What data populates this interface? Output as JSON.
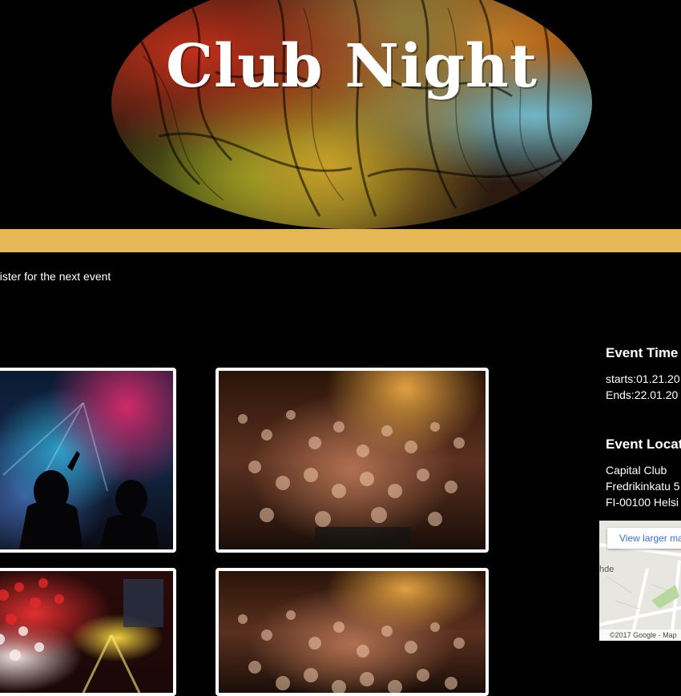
{
  "header": {
    "logo_text": "Club Night"
  },
  "intro": {
    "register_text": "gister for the next event"
  },
  "gallery": {
    "images": [
      {
        "name": "dj-stage-photo"
      },
      {
        "name": "crowd-photo"
      },
      {
        "name": "balloons-photo"
      },
      {
        "name": "crowd-photo-2"
      }
    ]
  },
  "sidebar": {
    "event_time_heading": "Event Time",
    "starts": "starts:01.21.20",
    "ends": "Ends:22.01.20",
    "event_location_heading": "Event Locat",
    "venue_name": "Capital Club",
    "street": "Fredrikinkatu 5",
    "city": "FI-00100 Helsi"
  },
  "map": {
    "button_label": "View larger ma",
    "street_label": "hde",
    "credit": "©2017 Google - Map"
  },
  "colors": {
    "background": "#000000",
    "accent_bar": "#e6b855",
    "text": "#ffffff",
    "map_link": "#3a6fd8"
  }
}
